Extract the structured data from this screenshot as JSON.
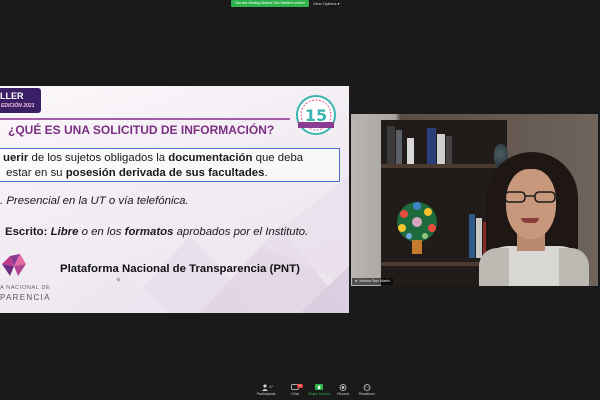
{
  "meeting": {
    "share_banner": "You are viewing Marina San Martin's screen",
    "view_options": "View Options"
  },
  "slide": {
    "brand_line1": "LLER",
    "brand_line2": "EDICIÓN 2021",
    "badge_number": "15",
    "title": "¿QUÉ ES UNA SOLICITUD DE INFORMACIÓN?",
    "definition": {
      "line1": [
        {
          "text": "uerir",
          "bold": true
        },
        {
          "text": " de los sujetos obligados la ",
          "bold": false
        },
        {
          "text": "documentación",
          "bold": true
        },
        {
          "text": " que deba",
          "bold": false
        }
      ],
      "line2": [
        {
          "text": " estar en su ",
          "bold": false
        },
        {
          "text": "posesión derivada de sus facultades",
          "bold": true
        },
        {
          "text": ".",
          "bold": false
        }
      ]
    },
    "bullet1": ". Presencial en la UT o vía telefónica.",
    "bullet2": [
      {
        "text": "Escrito: ",
        "bold": true,
        "italic": false
      },
      {
        "text": "Libre",
        "bold": true,
        "italic": true
      },
      {
        "text": " o en los ",
        "bold": false,
        "italic": true
      },
      {
        "text": "formatos",
        "bold": true,
        "italic": true
      },
      {
        "text": " aprobados por el Instituto.",
        "bold": false,
        "italic": true
      }
    ],
    "pnt": "Plataforma Nacional de Transparencia (PNT)",
    "logo_small": "A NACIONAL DE",
    "logo_large": "PARENCIA",
    "colors": {
      "title": "#7a2f82",
      "accent": "#a35ca8",
      "box_border": "#4b6fd1",
      "brand": "#3a1e66"
    }
  },
  "participant": {
    "name": "Marina San Martin"
  },
  "toolbar": {
    "participants_count": "47",
    "chat_badge": "99",
    "items": [
      {
        "label": "Participants",
        "icon": "participants-icon"
      },
      {
        "label": "Chat",
        "icon": "chat-icon"
      },
      {
        "label": "Share Screen",
        "icon": "share-screen-icon"
      },
      {
        "label": "Record",
        "icon": "record-icon"
      },
      {
        "label": "Reactions",
        "icon": "reactions-icon"
      }
    ]
  }
}
